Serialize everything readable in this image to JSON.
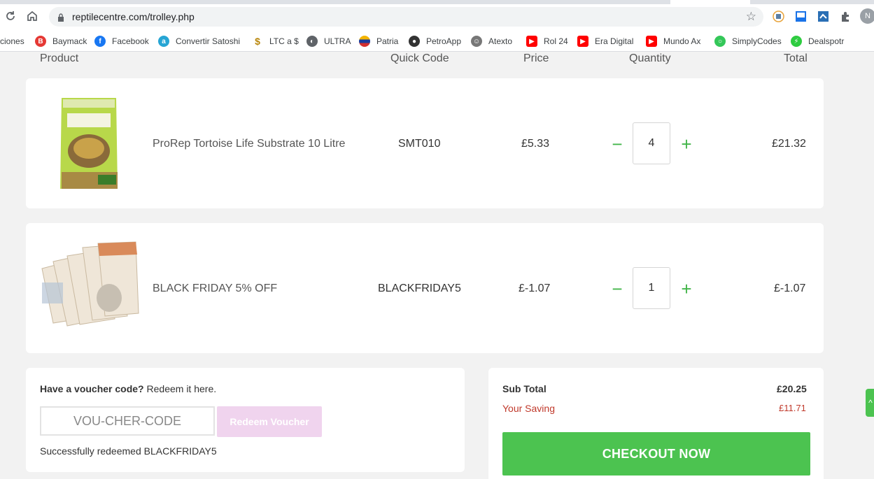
{
  "browser": {
    "url": "reptilecentre.com/trolley.php",
    "avatar_letter": "N",
    "bookmarks": [
      {
        "label": "ciones",
        "icon": "folder-icon",
        "color": ""
      },
      {
        "label": "Baymack",
        "icon": "baymack-icon",
        "color": "#e53935"
      },
      {
        "label": "Facebook",
        "icon": "facebook-icon",
        "color": "#1877f2"
      },
      {
        "label": "Convertir Satoshi",
        "icon": "satoshi-icon",
        "color": "#26a5d4"
      },
      {
        "label": "LTC a $",
        "icon": "dollar-icon",
        "color": "#b8860b"
      },
      {
        "label": "ULTRA",
        "icon": "globe-icon",
        "color": "#5f6368"
      },
      {
        "label": "Patria",
        "icon": "patria-icon",
        "color": "#f4b400"
      },
      {
        "label": "PetroApp",
        "icon": "petro-icon",
        "color": "#333333"
      },
      {
        "label": "Atexto",
        "icon": "atexto-icon",
        "color": "#666666"
      },
      {
        "label": "Rol 24",
        "icon": "youtube-icon",
        "color": "#ff0000"
      },
      {
        "label": "Era Digital",
        "icon": "youtube-icon",
        "color": "#ff0000"
      },
      {
        "label": "Mundo Ax",
        "icon": "youtube-icon",
        "color": "#ff0000"
      },
      {
        "label": "SimplyCodes",
        "icon": "simplycodes-icon",
        "color": "#34c759"
      },
      {
        "label": "Dealspotr",
        "icon": "dealspotr-icon",
        "color": "#2ecc40"
      }
    ]
  },
  "table": {
    "headers": {
      "product": "Product",
      "quick_code": "Quick Code",
      "price": "Price",
      "quantity": "Quantity",
      "total": "Total"
    }
  },
  "items": [
    {
      "name": "ProRep Tortoise Life Substrate 10 Litre",
      "code": "SMT010",
      "price": "£5.33",
      "qty": "4",
      "total": "£21.32",
      "image": "tortoise-substrate-bag-image"
    },
    {
      "name": "BLACK FRIDAY 5% OFF",
      "code": "BLACKFRIDAY5",
      "price": "£-1.07",
      "qty": "1",
      "total": "£-1.07",
      "image": "banknotes-image"
    }
  ],
  "voucher": {
    "title_bold": "Have a voucher code?",
    "title_rest": " Redeem it here.",
    "placeholder": "VOU-CHER-CODE",
    "button": "Redeem Voucher",
    "message": "Successfully redeemed BLACKFRIDAY5"
  },
  "summary": {
    "subtotal_label": "Sub Total",
    "subtotal_value": "£20.25",
    "saving_label": "Your Saving",
    "saving_value": "£11.71",
    "checkout": "CHECKOUT NOW"
  },
  "colors": {
    "accent": "#4cc350",
    "saving": "#c0392b",
    "redeem_disabled": "#f0d4ee"
  }
}
